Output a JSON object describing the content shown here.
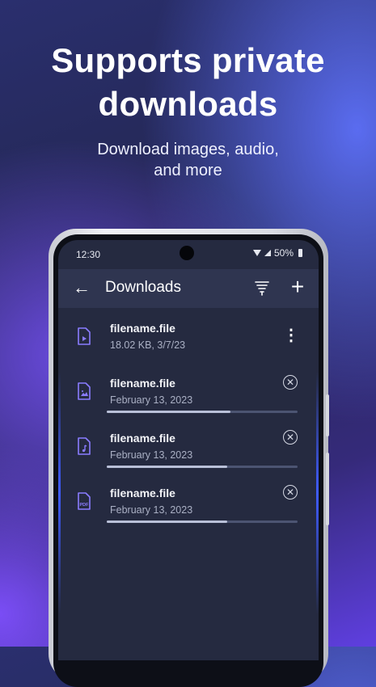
{
  "promo": {
    "headline_line1": "Supports private",
    "headline_line2": "downloads",
    "subtitle_line1": "Download images, audio,",
    "subtitle_line2": "and more"
  },
  "status_bar": {
    "time": "12:30",
    "battery": "50%"
  },
  "app_bar": {
    "title": "Downloads",
    "back_icon": "back-arrow-icon",
    "clear_icon": "sweep-icon",
    "add_icon": "plus-icon"
  },
  "downloads": [
    {
      "name": "filename.file",
      "meta": "18.02 KB, 3/7/23",
      "type": "video",
      "status": "complete",
      "action_icon": "more-vert-icon"
    },
    {
      "name": "filename.file",
      "meta": "February 13, 2023",
      "type": "image",
      "status": "downloading",
      "progress": 0.65,
      "action_icon": "cancel-icon"
    },
    {
      "name": "filename.file",
      "meta": "February 13, 2023",
      "type": "audio",
      "status": "downloading",
      "progress": 0.63,
      "action_icon": "cancel-icon"
    },
    {
      "name": "filename.file",
      "meta": "February 13, 2023",
      "type": "pdf",
      "status": "downloading",
      "progress": 0.63,
      "action_icon": "cancel-icon"
    }
  ],
  "colors": {
    "accent": "#8a7cff",
    "screen_bg": "#252a40",
    "appbar_bg": "#2f3550",
    "progress_fill": "#b9c0d8"
  }
}
